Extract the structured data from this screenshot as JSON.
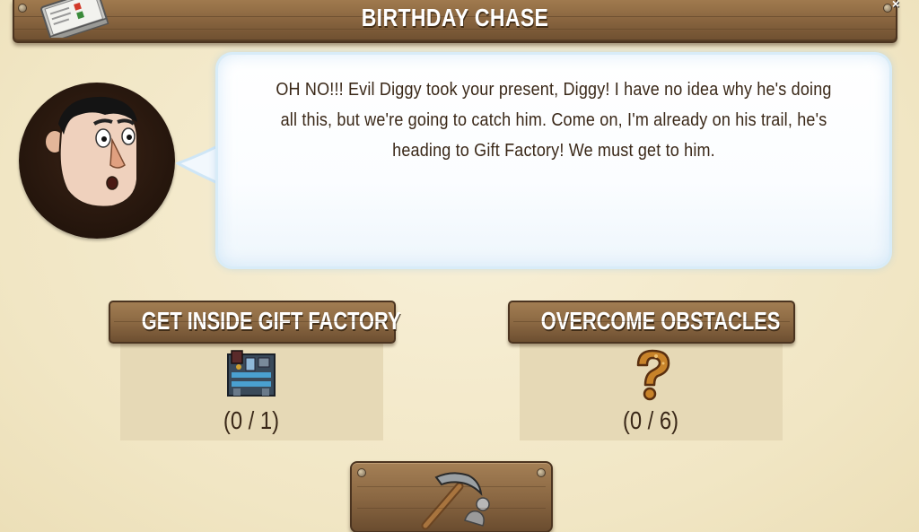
{
  "dialog": {
    "title": "BIRTHDAY CHASE",
    "close_symbol": "×",
    "header_icon": "quest-book-icon"
  },
  "character": {
    "portrait_icon": "diggy-portrait-icon"
  },
  "speech": {
    "text": "OH NO!!! Evil Diggy took your present, Diggy! I have no idea why he's doing all this, but we're going to catch him. Come on, I'm already on his trail, he's heading to Gift Factory! We must get to him."
  },
  "tasks": [
    {
      "title": "GET INSIDE GIFT FACTORY",
      "icon": "gift-factory-icon",
      "progress": "(0 / 1)",
      "current": 0,
      "total": 1
    },
    {
      "title": "OVERCOME OBSTACLES",
      "icon": "question-mark-icon",
      "progress": "(0 / 6)",
      "current": 0,
      "total": 6
    }
  ],
  "action": {
    "icon": "pickaxe-icon"
  },
  "colors": {
    "wood": "#8c6943",
    "wood_dark": "#4b3420",
    "parchment": "#f1e6c4",
    "task_panel": "#e6d9b6",
    "text_dark": "#3a2818",
    "bubble_glow": "#d8ecf8"
  }
}
